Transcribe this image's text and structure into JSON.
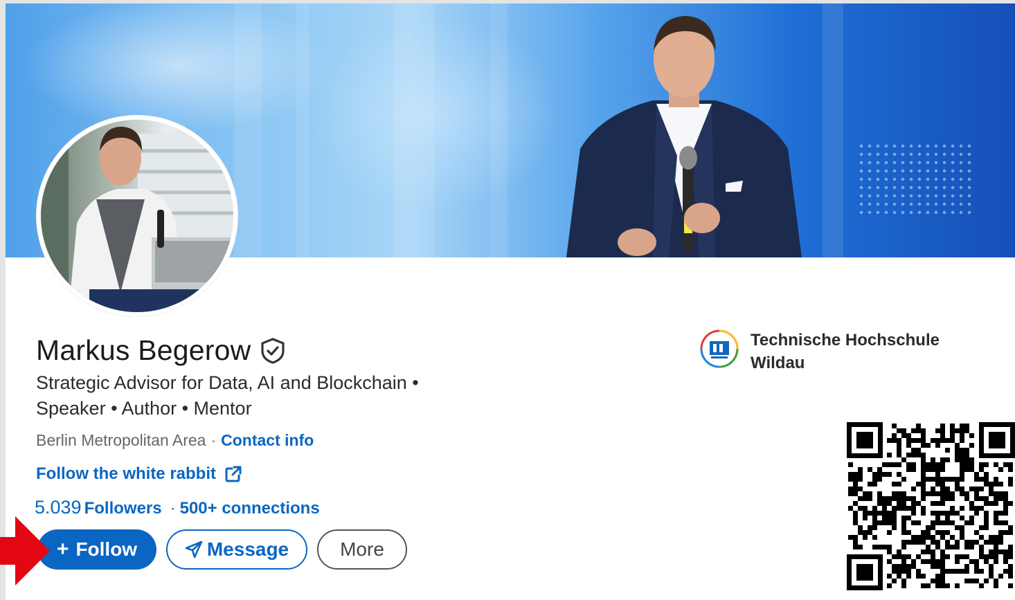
{
  "colors": {
    "accent": "#0a66c2",
    "arrow": "#e30613"
  },
  "profile": {
    "name": "Markus Begerow",
    "verified_icon": "shield-check-icon",
    "headline": "Strategic Advisor for Data, AI and Blockchain • Speaker • Author • Mentor",
    "location": "Berlin Metropolitan Area",
    "contact_info": "Contact info",
    "website": "Follow the white rabbit",
    "website_icon": "external-link-icon",
    "followers_count": "5.039",
    "followers_label": "Followers",
    "connections": "500+ connections"
  },
  "actions": {
    "follow": "Follow",
    "follow_prefix": "+",
    "message": "Message",
    "message_icon": "send-icon",
    "more": "More"
  },
  "education": {
    "school": "Technische Hochschule Wildau",
    "logo": "university-logo"
  },
  "qr_icon": "qr-code"
}
